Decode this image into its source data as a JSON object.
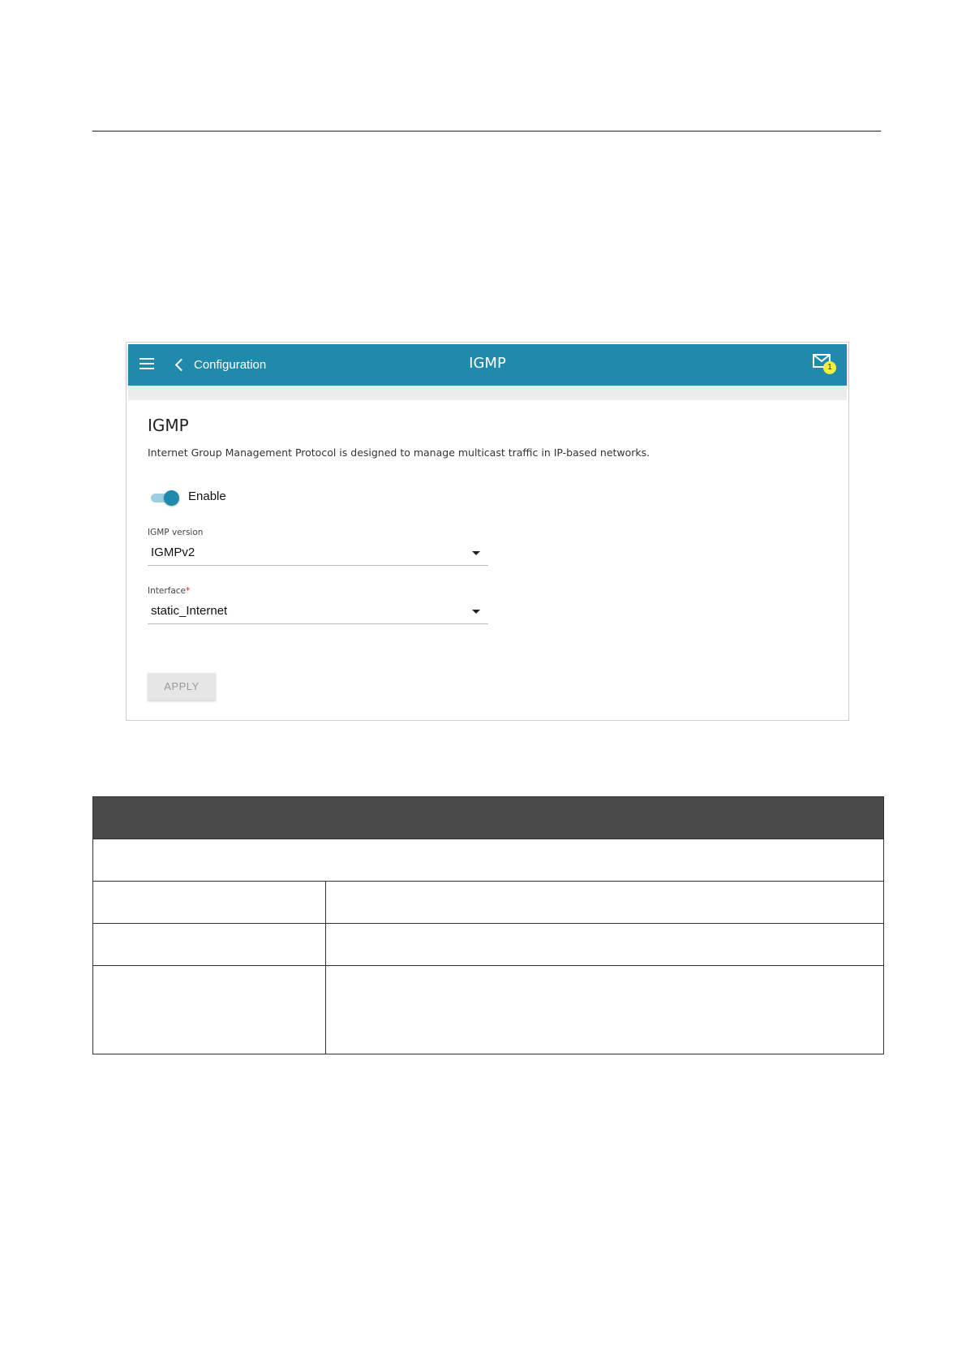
{
  "topbar": {
    "back_label": "Configuration",
    "title": "IGMP",
    "notification_count": "1",
    "color": "#1f8aac"
  },
  "section": {
    "title": "IGMP",
    "description": "Internet Group Management Protocol is designed to manage multicast traffic in IP-based networks."
  },
  "enable": {
    "label": "Enable",
    "on": true
  },
  "igmp_version": {
    "label": "IGMP version",
    "value": "IGMPv2"
  },
  "interface": {
    "label": "Interface",
    "required_mark": "*",
    "value": "static_Internet"
  },
  "apply_label": "APPLY",
  "table": {
    "header": "",
    "section_row": "",
    "rows": [
      {
        "param": "",
        "desc": ""
      },
      {
        "param": "",
        "desc": ""
      },
      {
        "param": "",
        "desc": ""
      }
    ]
  }
}
